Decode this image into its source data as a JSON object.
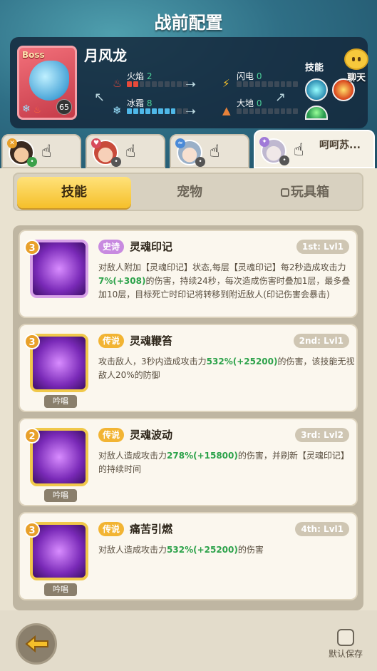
{
  "header": {
    "title": "战前配置",
    "chat_label": "聊天"
  },
  "boss": {
    "tag": "Boss",
    "name": "月风龙",
    "level": "65",
    "stats": [
      {
        "name": "火焰",
        "value": "2",
        "filled": 2
      },
      {
        "name": "闪电",
        "value": "0",
        "filled": 0
      },
      {
        "name": "冰霜",
        "value": "8",
        "filled": 8
      },
      {
        "name": "大地",
        "value": "0",
        "filled": 0
      }
    ],
    "skills_label": "技能"
  },
  "team": [
    {
      "chat": ""
    },
    {
      "chat": ""
    },
    {
      "chat": ""
    },
    {
      "chat": "呵呵苏..."
    }
  ],
  "tabs": {
    "skills": "技能",
    "pets": "宠物",
    "toys": "玩具箱"
  },
  "skills": [
    {
      "level": "3",
      "rarity": "史诗",
      "name": "灵魂印记",
      "slot": "1st: Lvl1",
      "desc_a": "对敌人附加【灵魂印记】状态,每层【灵魂印记】每2秒造成攻击力",
      "pct": "7%",
      "bonus": "(+308)",
      "desc_b": "的伤害，持续24秒，每次造成伤害时叠加1层，最多叠加10层，目标死亡时印记将转移到附近敌人(印记伤害会暴击)",
      "chant": ""
    },
    {
      "level": "3",
      "rarity": "传说",
      "name": "灵魂鞭笞",
      "slot": "2nd: Lvl1",
      "desc_a": "攻击敌人，3秒内造成攻击力",
      "pct": "532%",
      "bonus": "(+25200)",
      "desc_b": "的伤害，该技能无视敌人20%的防御",
      "chant": "吟唱"
    },
    {
      "level": "2",
      "rarity": "传说",
      "name": "灵魂波动",
      "slot": "3rd: Lvl2",
      "desc_a": "对敌人造成攻击力",
      "pct": "278%",
      "bonus": "(+15800)",
      "desc_b": "的伤害，并刷新【灵魂印记】的持续时间",
      "chant": "吟唱"
    },
    {
      "level": "3",
      "rarity": "传说",
      "name": "痛苦引燃",
      "slot": "4th: Lvl1",
      "desc_a": "对敌人造成攻击力",
      "pct": "532%",
      "bonus": "(+25200)",
      "desc_b": "的伤害",
      "chant": "吟唱"
    }
  ],
  "footer": {
    "default_save": "默认保存"
  },
  "colors": {
    "accent": "#f5bf2a",
    "bonus_green": "#2ca24a",
    "panel": "#e9e2d0"
  }
}
